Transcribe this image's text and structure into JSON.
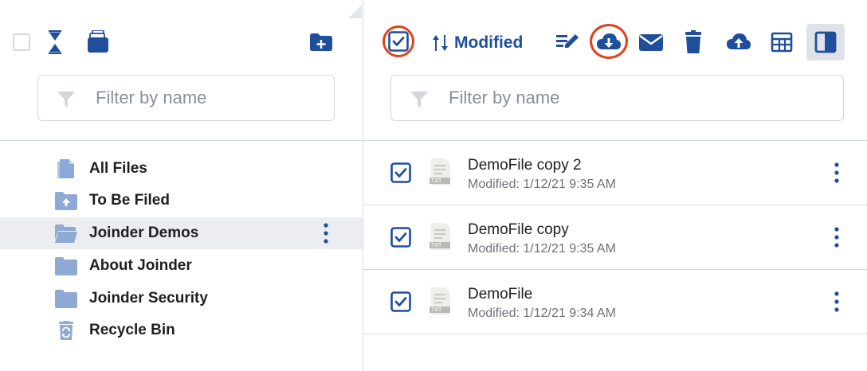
{
  "left_pane": {
    "filter_placeholder": "Filter by name",
    "tree": [
      {
        "label": "All Files",
        "icon": "document-icon"
      },
      {
        "label": "To Be Filed",
        "icon": "upload-folder-icon"
      },
      {
        "label": "Joinder Demos",
        "icon": "open-folder-icon",
        "selected": true
      },
      {
        "label": "About Joinder",
        "icon": "folder-icon"
      },
      {
        "label": "Joinder Security",
        "icon": "folder-icon"
      },
      {
        "label": "Recycle Bin",
        "icon": "recycle-bin-icon"
      }
    ]
  },
  "right_pane": {
    "sort_label": "Modified",
    "filter_placeholder": "Filter by name",
    "files": [
      {
        "name": "DemoFile copy 2",
        "modified": "Modified: 1/12/21 9:35 AM",
        "type_badge": "TXT",
        "checked": true
      },
      {
        "name": "DemoFile copy",
        "modified": "Modified: 1/12/21 9:35 AM",
        "type_badge": "TXT",
        "checked": true
      },
      {
        "name": "DemoFile",
        "modified": "Modified: 1/12/21 9:34 AM",
        "type_badge": "TXT",
        "checked": true
      }
    ]
  },
  "colors": {
    "brand_blue": "#1f4e9b",
    "folder_blue": "#8fa9d6",
    "highlight_red": "#e0421e",
    "selected_row": "#ecedf0"
  }
}
